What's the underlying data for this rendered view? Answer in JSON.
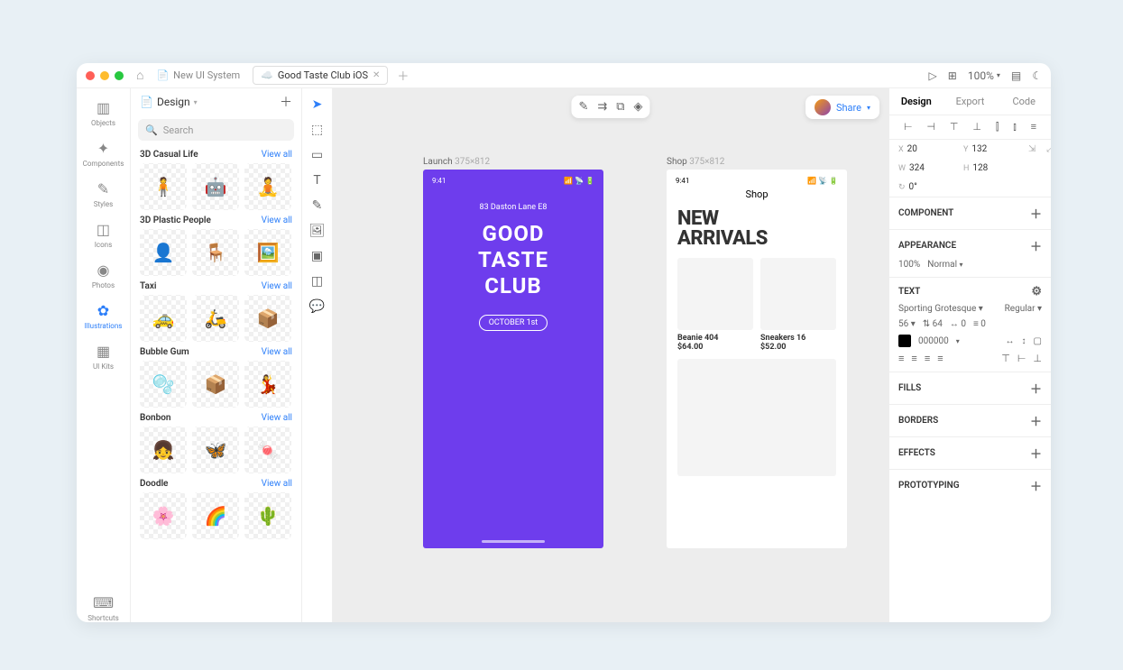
{
  "tabs": {
    "inactive": "New UI System",
    "active": "Good Taste Club iOS"
  },
  "zoom": "100%",
  "page": "Design",
  "search_placeholder": "Search",
  "rail": {
    "objects": "Objects",
    "components": "Components",
    "styles": "Styles",
    "icons": "Icons",
    "photos": "Photos",
    "illustrations": "Illustrations",
    "uikits": "UI Kits",
    "shortcuts": "Shortcuts"
  },
  "cats": {
    "viewall": "View all",
    "c1": "3D Casual Life",
    "c2": "3D Plastic People",
    "c3": "Taxi",
    "c4": "Bubble Gum",
    "c5": "Bonbon",
    "c6": "Doodle"
  },
  "share": "Share",
  "frames": {
    "f1": {
      "name": "Launch",
      "dim": "375×812"
    },
    "f2": {
      "name": "Shop",
      "dim": "375×812"
    }
  },
  "ab1": {
    "time": "9:41",
    "addr": "83 Daston Lane E8",
    "title1": "GOOD",
    "title2": "TASTE",
    "title3": "CLUB",
    "pill": "OCTOBER 1st"
  },
  "ab2": {
    "time": "9:41",
    "shop": "Shop",
    "h1": "NEW",
    "h2": "ARRIVALS",
    "p1": {
      "name": "Beanie 404",
      "price": "$64.00"
    },
    "p2": {
      "name": "Sneakers 16",
      "price": "$52.00"
    }
  },
  "insp": {
    "tabs": {
      "design": "Design",
      "export": "Export",
      "code": "Code"
    },
    "x": {
      "l": "X",
      "v": "20"
    },
    "y": {
      "l": "Y",
      "v": "132"
    },
    "w": {
      "l": "W",
      "v": "324"
    },
    "h": {
      "l": "H",
      "v": "128"
    },
    "r": {
      "l": "↻",
      "v": "0°"
    },
    "component": "COMPONENT",
    "appearance": "APPEARANCE",
    "opacity": "100%",
    "blend": "Normal",
    "text": "TEXT",
    "font": "Sporting Grotesque",
    "weight": "Regular",
    "size": "56",
    "lh": "64",
    "ls": "0",
    "para": "0",
    "color": "000000",
    "fills": "FILLS",
    "borders": "BORDERS",
    "effects": "EFFECTS",
    "prototyping": "PROTOTYPING"
  }
}
